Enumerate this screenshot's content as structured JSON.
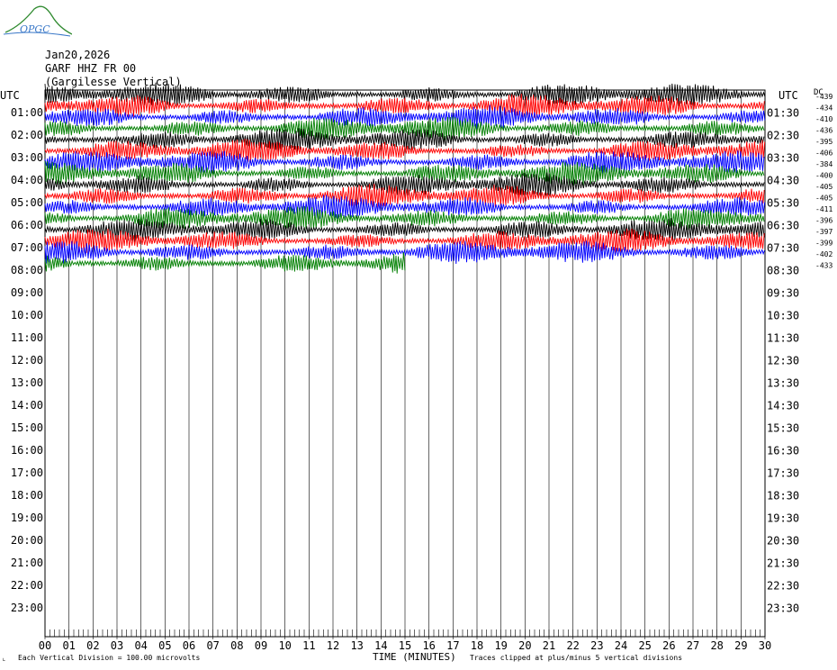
{
  "header": {
    "logo_text": "OPGC",
    "date": "Jan20,2026",
    "station": "GARF HHZ FR 00",
    "location": "(Gargilesse Vertical)"
  },
  "chart_data": {
    "type": "line",
    "title": "GARF HHZ FR 00 (Gargilesse Vertical)",
    "date": "Jan20,2026",
    "xlabel": "TIME (MINUTES)",
    "x_ticks": [
      "00",
      "01",
      "02",
      "03",
      "04",
      "05",
      "06",
      "07",
      "08",
      "09",
      "10",
      "11",
      "12",
      "13",
      "14",
      "15",
      "16",
      "17",
      "18",
      "19",
      "20",
      "21",
      "22",
      "23",
      "24",
      "25",
      "26",
      "27",
      "28",
      "29",
      "30"
    ],
    "xlim": [
      0,
      30
    ],
    "left_axis_title": "UTC",
    "right_axis_title": "UTC",
    "left_labels": [
      "01:00",
      "02:00",
      "03:00",
      "04:00",
      "05:00",
      "06:00",
      "07:00",
      "08:00",
      "09:00",
      "10:00",
      "11:00",
      "12:00",
      "13:00",
      "14:00",
      "15:00",
      "16:00",
      "17:00",
      "18:00",
      "19:00",
      "20:00",
      "21:00",
      "22:00",
      "23:00"
    ],
    "right_labels": [
      "01:30",
      "02:30",
      "03:30",
      "04:30",
      "05:30",
      "06:30",
      "07:30",
      "08:30",
      "09:30",
      "10:30",
      "11:30",
      "12:30",
      "13:30",
      "14:30",
      "15:30",
      "16:30",
      "17:30",
      "18:30",
      "19:30",
      "20:30",
      "21:30",
      "22:30",
      "23:30"
    ],
    "dc_title": "DC",
    "dc_offsets": [
      "-439",
      "-434",
      "-410",
      "-436",
      "-395",
      "-406",
      "-384",
      "-400",
      "-405",
      "-405",
      "-411",
      "-396",
      "-397",
      "-399",
      "-402",
      "-433"
    ],
    "trace_colors": [
      "#000000",
      "#ff0000",
      "#0000ff",
      "#007f00"
    ],
    "traces_recorded": 16,
    "last_trace_minutes": 15,
    "scale_note": "Each Vertical Division =  100.00 microvolts",
    "clip_note": "Traces clipped at plus/minus 5 vertical divisions",
    "grid": true
  }
}
